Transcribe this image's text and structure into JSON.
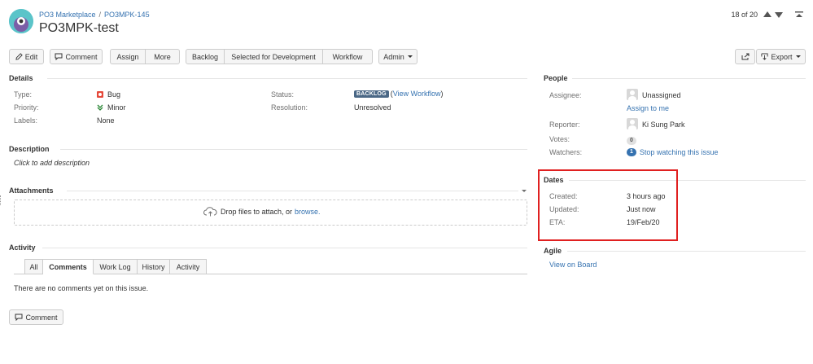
{
  "header": {
    "breadcrumb": [
      "PO3 Marketplace",
      "PO3MPK-145"
    ],
    "breadcrumb_separator": "/",
    "title": "PO3MPK-test",
    "pager": "18 of 20"
  },
  "toolbar": {
    "edit": "Edit",
    "comment": "Comment",
    "assign": "Assign",
    "more": "More",
    "backlog": "Backlog",
    "selected_for_development": "Selected for Development",
    "workflow": "Workflow",
    "admin": "Admin",
    "export": "Export"
  },
  "details": {
    "heading": "Details",
    "type_label": "Type:",
    "type_value": "Bug",
    "priority_label": "Priority:",
    "priority_value": "Minor",
    "labels_label": "Labels:",
    "labels_value": "None",
    "status_label": "Status:",
    "status_value": "BACKLOG",
    "view_workflow": "View Workflow",
    "resolution_label": "Resolution:",
    "resolution_value": "Unresolved"
  },
  "description": {
    "heading": "Description",
    "placeholder": "Click to add description"
  },
  "attachments": {
    "heading": "Attachments",
    "drop_text": "Drop files to attach, or",
    "browse": "browse."
  },
  "activity": {
    "heading": "Activity",
    "tabs": [
      "All",
      "Comments",
      "Work Log",
      "History",
      "Activity"
    ],
    "active_tab": "Comments",
    "empty": "There are no comments yet on this issue.",
    "comment_button": "Comment"
  },
  "people": {
    "heading": "People",
    "assignee_label": "Assignee:",
    "assignee_value": "Unassigned",
    "assign_to_me": "Assign to me",
    "reporter_label": "Reporter:",
    "reporter_value": "Ki Sung Park",
    "votes_label": "Votes:",
    "votes_value": "0",
    "watchers_label": "Watchers:",
    "watchers_count": "1",
    "stop_watching": "Stop watching this issue"
  },
  "dates": {
    "heading": "Dates",
    "created_label": "Created:",
    "created_value": "3 hours ago",
    "updated_label": "Updated:",
    "updated_value": "Just now",
    "eta_label": "ETA:",
    "eta_value": "19/Feb/20"
  },
  "agile": {
    "heading": "Agile",
    "view_on_board": "View on Board"
  },
  "colors": {
    "link": "#3572b0",
    "bug": "#e5493a",
    "minor": "#2a8735",
    "status_lozenge": "#4a6785",
    "highlight": "#e02020"
  }
}
